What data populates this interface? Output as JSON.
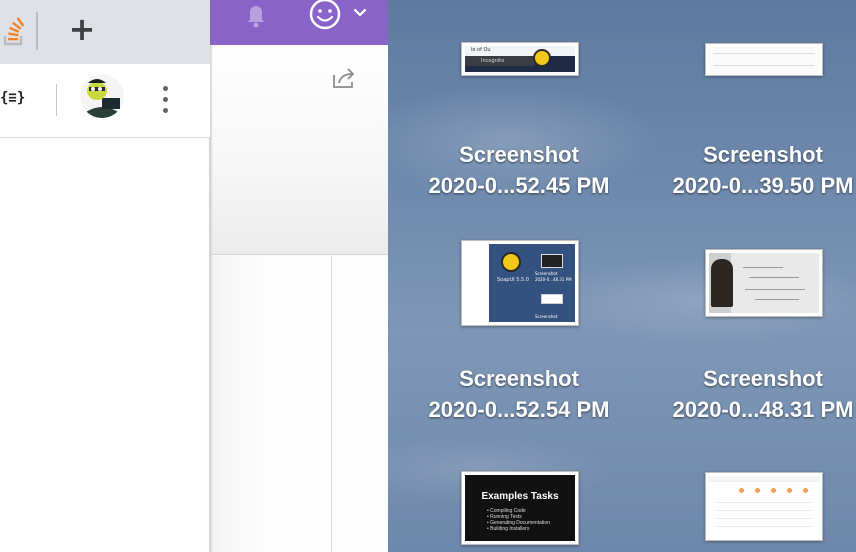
{
  "browser": {
    "extension_label": "{≡}",
    "newtab_symbol": "+",
    "brand_orange": "#f48024"
  },
  "app": {
    "accent": "#8a63c8"
  },
  "desktop": {
    "files": [
      {
        "line1": "Screenshot",
        "line2": "2020-0...52.45 PM"
      },
      {
        "line1": "Screenshot",
        "line2": "2020-0...39.50 PM"
      },
      {
        "line1": "Screenshot",
        "line2": "2020-0...52.54 PM"
      },
      {
        "line1": "Screenshot",
        "line2": "2020-0...48.31 PM"
      },
      {
        "line1": "",
        "line2": ""
      },
      {
        "line1": "",
        "line2": ""
      }
    ],
    "thumb_text": {
      "t1_tab": "le of Ou",
      "t1_incognito": "Incognito",
      "t3_app": "SoapUI 5.5.0",
      "t3_cap1": "Screenshot",
      "t3_cap2": "2020-0...48.31 PM",
      "t3_cap3": "Screenshot",
      "t5_title": "Examples Tasks",
      "t5_items": [
        "• Compiling Code",
        "• Running Tests",
        "• Generating Documentation",
        "• Building Installers"
      ]
    }
  }
}
